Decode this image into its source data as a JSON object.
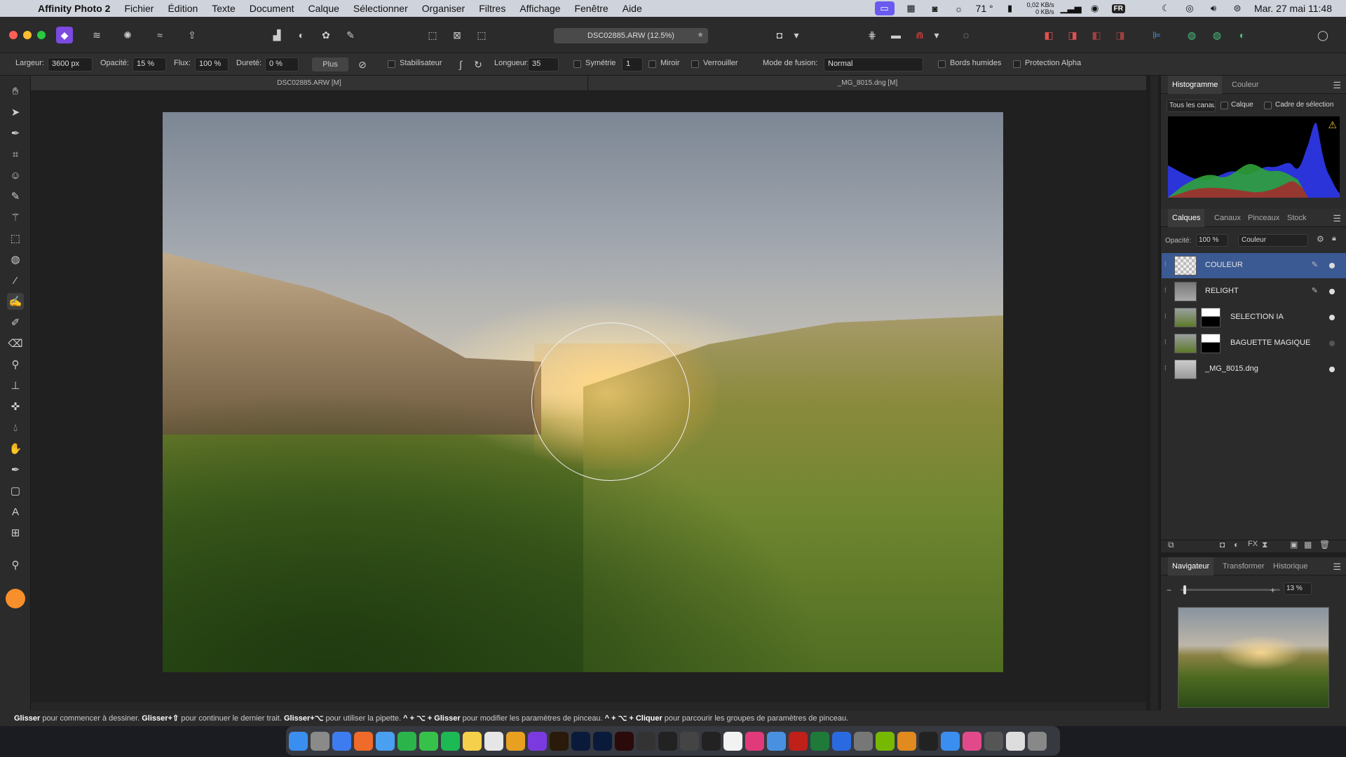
{
  "menubar": {
    "app_name": "Affinity Photo 2",
    "items": [
      "Fichier",
      "Édition",
      "Texte",
      "Document",
      "Calque",
      "Sélectionner",
      "Organiser",
      "Filtres",
      "Affichage",
      "Fenêtre",
      "Aide"
    ],
    "temperature": "71 °",
    "net_up": "0,02 KB/s",
    "net_down": "0 KB/s",
    "keyboard": "FR",
    "datetime": "Mar. 27 mai 11:48"
  },
  "toolbar": {
    "document_title": "DSC02885.ARW (12.5%)"
  },
  "context": {
    "width_label": "Largeur:",
    "width_value": "3600 px",
    "opacity_label": "Opacité:",
    "opacity_value": "15 %",
    "flow_label": "Flux:",
    "flow_value": "100 %",
    "hardness_label": "Dureté:",
    "hardness_value": "0 %",
    "plus_button": "Plus",
    "stabiliser_label": "Stabilisateur",
    "length_label": "Longueur:",
    "length_value": "35",
    "symmetry_label": "Symétrie",
    "symmetry_value": "1",
    "mirror_label": "Miroir",
    "lock_label": "Verrouiller",
    "blend_label": "Mode de fusion:",
    "blend_value": "Normal",
    "wet_edges_label": "Bords humides",
    "alpha_label": "Protection Alpha"
  },
  "doc_tabs": [
    "DSC02885.ARW [M]",
    "_MG_8015.dng [M]"
  ],
  "histogram_panel": {
    "tabs": [
      "Histogramme",
      "Couleur"
    ],
    "channel": "Tous les canaux",
    "layer_label": "Calque",
    "selection_label": "Cadre de sélection"
  },
  "layers_panel": {
    "tabs": [
      "Calques",
      "Canaux",
      "Pinceaux",
      "Stock"
    ],
    "opacity_label": "Opacité:",
    "opacity_value": "100 %",
    "blend_value": "Couleur",
    "layers": [
      {
        "name": "COULEUR",
        "selected": true,
        "mask": false
      },
      {
        "name": "RELIGHT",
        "selected": false,
        "mask": false
      },
      {
        "name": "SELECTION IA",
        "selected": false,
        "mask": true
      },
      {
        "name": "BAGUETTE MAGIQUE",
        "selected": false,
        "mask": true
      },
      {
        "name": "_MG_8015.dng",
        "selected": false,
        "mask": false
      }
    ]
  },
  "navigator_panel": {
    "tabs": [
      "Navigateur",
      "Transformer",
      "Historique"
    ],
    "zoom_value": "13 %"
  },
  "statusbar": {
    "k1": "Glisser",
    "t1": " pour commencer à dessiner. ",
    "k2": "Glisser+⇧",
    "t2": " pour continuer le dernier trait. ",
    "k3": "Glisser+⌥",
    "t3": " pour utiliser la pipette. ",
    "k4": "^ + ⌥ + Glisser",
    "t4": " pour modifier les paramètres de pinceau. ",
    "k5": "^ + ⌥ + Cliquer",
    "t5": " pour parcourir les groupes de paramètres de pinceau."
  },
  "dock_apps": [
    "Finder",
    "Paramètres",
    "Safari",
    "Firefox",
    "Mail",
    "WhatsApp",
    "Messages",
    "Spotify",
    "Notes",
    "Photos",
    "Affinity",
    "Affinity Photo",
    "Br",
    "Ps",
    "LrC",
    "Ai",
    "Aperture",
    "Terminal",
    "Live",
    "KT",
    "Unity",
    "Prism",
    "Xcode",
    "FileZilla",
    "Excel",
    "Windows",
    "Sketchup",
    "Nvidia",
    "Sublime",
    "Activity",
    "iCloud",
    "Slack",
    "Live",
    "Doc",
    "Trash"
  ],
  "colors": {
    "accent": "#3b5a93",
    "primary_color": "#f7902a"
  }
}
